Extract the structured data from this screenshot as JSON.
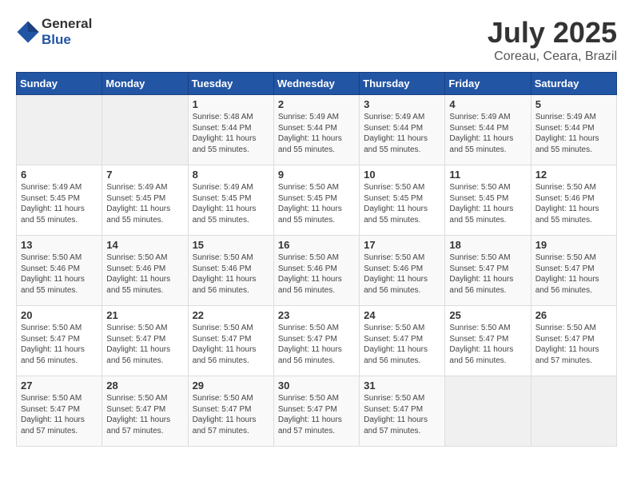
{
  "header": {
    "logo_general": "General",
    "logo_blue": "Blue",
    "month": "July 2025",
    "location": "Coreau, Ceara, Brazil"
  },
  "weekdays": [
    "Sunday",
    "Monday",
    "Tuesday",
    "Wednesday",
    "Thursday",
    "Friday",
    "Saturday"
  ],
  "weeks": [
    [
      {
        "day": "",
        "sunrise": "",
        "sunset": "",
        "daylight": ""
      },
      {
        "day": "",
        "sunrise": "",
        "sunset": "",
        "daylight": ""
      },
      {
        "day": "1",
        "sunrise": "Sunrise: 5:48 AM",
        "sunset": "Sunset: 5:44 PM",
        "daylight": "Daylight: 11 hours and 55 minutes."
      },
      {
        "day": "2",
        "sunrise": "Sunrise: 5:49 AM",
        "sunset": "Sunset: 5:44 PM",
        "daylight": "Daylight: 11 hours and 55 minutes."
      },
      {
        "day": "3",
        "sunrise": "Sunrise: 5:49 AM",
        "sunset": "Sunset: 5:44 PM",
        "daylight": "Daylight: 11 hours and 55 minutes."
      },
      {
        "day": "4",
        "sunrise": "Sunrise: 5:49 AM",
        "sunset": "Sunset: 5:44 PM",
        "daylight": "Daylight: 11 hours and 55 minutes."
      },
      {
        "day": "5",
        "sunrise": "Sunrise: 5:49 AM",
        "sunset": "Sunset: 5:44 PM",
        "daylight": "Daylight: 11 hours and 55 minutes."
      }
    ],
    [
      {
        "day": "6",
        "sunrise": "Sunrise: 5:49 AM",
        "sunset": "Sunset: 5:45 PM",
        "daylight": "Daylight: 11 hours and 55 minutes."
      },
      {
        "day": "7",
        "sunrise": "Sunrise: 5:49 AM",
        "sunset": "Sunset: 5:45 PM",
        "daylight": "Daylight: 11 hours and 55 minutes."
      },
      {
        "day": "8",
        "sunrise": "Sunrise: 5:49 AM",
        "sunset": "Sunset: 5:45 PM",
        "daylight": "Daylight: 11 hours and 55 minutes."
      },
      {
        "day": "9",
        "sunrise": "Sunrise: 5:50 AM",
        "sunset": "Sunset: 5:45 PM",
        "daylight": "Daylight: 11 hours and 55 minutes."
      },
      {
        "day": "10",
        "sunrise": "Sunrise: 5:50 AM",
        "sunset": "Sunset: 5:45 PM",
        "daylight": "Daylight: 11 hours and 55 minutes."
      },
      {
        "day": "11",
        "sunrise": "Sunrise: 5:50 AM",
        "sunset": "Sunset: 5:45 PM",
        "daylight": "Daylight: 11 hours and 55 minutes."
      },
      {
        "day": "12",
        "sunrise": "Sunrise: 5:50 AM",
        "sunset": "Sunset: 5:46 PM",
        "daylight": "Daylight: 11 hours and 55 minutes."
      }
    ],
    [
      {
        "day": "13",
        "sunrise": "Sunrise: 5:50 AM",
        "sunset": "Sunset: 5:46 PM",
        "daylight": "Daylight: 11 hours and 55 minutes."
      },
      {
        "day": "14",
        "sunrise": "Sunrise: 5:50 AM",
        "sunset": "Sunset: 5:46 PM",
        "daylight": "Daylight: 11 hours and 55 minutes."
      },
      {
        "day": "15",
        "sunrise": "Sunrise: 5:50 AM",
        "sunset": "Sunset: 5:46 PM",
        "daylight": "Daylight: 11 hours and 56 minutes."
      },
      {
        "day": "16",
        "sunrise": "Sunrise: 5:50 AM",
        "sunset": "Sunset: 5:46 PM",
        "daylight": "Daylight: 11 hours and 56 minutes."
      },
      {
        "day": "17",
        "sunrise": "Sunrise: 5:50 AM",
        "sunset": "Sunset: 5:46 PM",
        "daylight": "Daylight: 11 hours and 56 minutes."
      },
      {
        "day": "18",
        "sunrise": "Sunrise: 5:50 AM",
        "sunset": "Sunset: 5:47 PM",
        "daylight": "Daylight: 11 hours and 56 minutes."
      },
      {
        "day": "19",
        "sunrise": "Sunrise: 5:50 AM",
        "sunset": "Sunset: 5:47 PM",
        "daylight": "Daylight: 11 hours and 56 minutes."
      }
    ],
    [
      {
        "day": "20",
        "sunrise": "Sunrise: 5:50 AM",
        "sunset": "Sunset: 5:47 PM",
        "daylight": "Daylight: 11 hours and 56 minutes."
      },
      {
        "day": "21",
        "sunrise": "Sunrise: 5:50 AM",
        "sunset": "Sunset: 5:47 PM",
        "daylight": "Daylight: 11 hours and 56 minutes."
      },
      {
        "day": "22",
        "sunrise": "Sunrise: 5:50 AM",
        "sunset": "Sunset: 5:47 PM",
        "daylight": "Daylight: 11 hours and 56 minutes."
      },
      {
        "day": "23",
        "sunrise": "Sunrise: 5:50 AM",
        "sunset": "Sunset: 5:47 PM",
        "daylight": "Daylight: 11 hours and 56 minutes."
      },
      {
        "day": "24",
        "sunrise": "Sunrise: 5:50 AM",
        "sunset": "Sunset: 5:47 PM",
        "daylight": "Daylight: 11 hours and 56 minutes."
      },
      {
        "day": "25",
        "sunrise": "Sunrise: 5:50 AM",
        "sunset": "Sunset: 5:47 PM",
        "daylight": "Daylight: 11 hours and 56 minutes."
      },
      {
        "day": "26",
        "sunrise": "Sunrise: 5:50 AM",
        "sunset": "Sunset: 5:47 PM",
        "daylight": "Daylight: 11 hours and 57 minutes."
      }
    ],
    [
      {
        "day": "27",
        "sunrise": "Sunrise: 5:50 AM",
        "sunset": "Sunset: 5:47 PM",
        "daylight": "Daylight: 11 hours and 57 minutes."
      },
      {
        "day": "28",
        "sunrise": "Sunrise: 5:50 AM",
        "sunset": "Sunset: 5:47 PM",
        "daylight": "Daylight: 11 hours and 57 minutes."
      },
      {
        "day": "29",
        "sunrise": "Sunrise: 5:50 AM",
        "sunset": "Sunset: 5:47 PM",
        "daylight": "Daylight: 11 hours and 57 minutes."
      },
      {
        "day": "30",
        "sunrise": "Sunrise: 5:50 AM",
        "sunset": "Sunset: 5:47 PM",
        "daylight": "Daylight: 11 hours and 57 minutes."
      },
      {
        "day": "31",
        "sunrise": "Sunrise: 5:50 AM",
        "sunset": "Sunset: 5:47 PM",
        "daylight": "Daylight: 11 hours and 57 minutes."
      },
      {
        "day": "",
        "sunrise": "",
        "sunset": "",
        "daylight": ""
      },
      {
        "day": "",
        "sunrise": "",
        "sunset": "",
        "daylight": ""
      }
    ]
  ]
}
